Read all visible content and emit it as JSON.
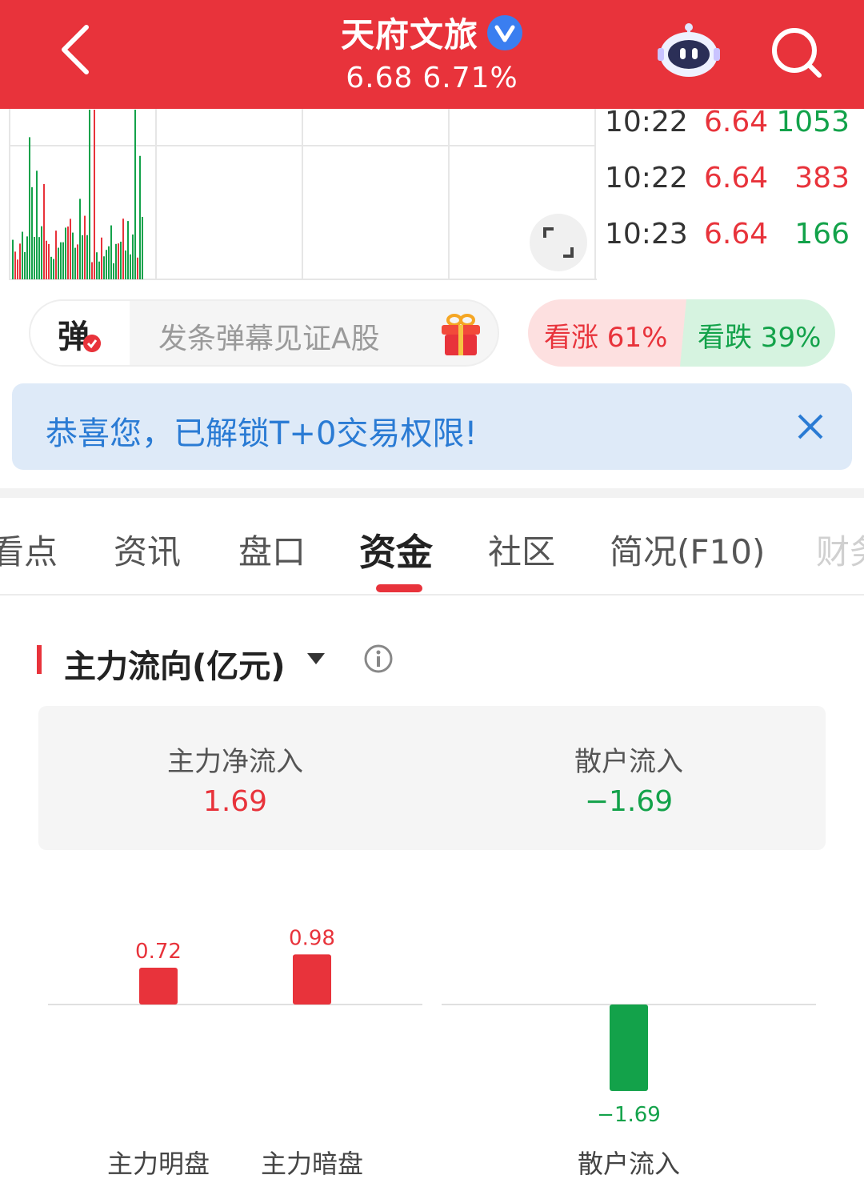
{
  "header": {
    "title": "天府文旅",
    "price": "6.68",
    "change_pct": "6.71%",
    "icons": [
      "back-icon",
      "verified-icon",
      "robot-assistant-icon",
      "search-icon"
    ]
  },
  "colors": {
    "up": "#e8333b",
    "down": "#13a24a",
    "accent": "#e8333b",
    "banner_text": "#2a7bd4"
  },
  "ticks": [
    {
      "time": "10:22",
      "price": "6.64",
      "volume": "1053",
      "dir": "down"
    },
    {
      "time": "10:22",
      "price": "6.64",
      "volume": "383",
      "dir": "up"
    },
    {
      "time": "10:23",
      "price": "6.64",
      "volume": "166",
      "dir": "down"
    }
  ],
  "danmu": {
    "icon_char": "弹",
    "placeholder": "发条弹幕见证A股"
  },
  "sentiment": {
    "bull": "看涨 61%",
    "bear": "看跌 39%",
    "bull_ratio": 0.61
  },
  "banner": {
    "text": "恭喜您，已解锁T+0交易权限!"
  },
  "tabs": [
    {
      "label": "看点"
    },
    {
      "label": "资讯"
    },
    {
      "label": "盘口"
    },
    {
      "label": "资金",
      "active": true
    },
    {
      "label": "社区"
    },
    {
      "label": "简况(F10)"
    },
    {
      "label": "财务"
    }
  ],
  "section": {
    "title": "主力流向(亿元)"
  },
  "summary": {
    "main_label": "主力净流入",
    "main_value": "1.69",
    "retail_label": "散户流入",
    "retail_value": "−1.69"
  },
  "chart_data": {
    "type": "bar",
    "categories": [
      "主力明盘",
      "主力暗盘",
      "散户流入"
    ],
    "values": [
      0.72,
      0.98,
      -1.69
    ],
    "value_labels": [
      "0.72",
      "0.98",
      "−1.69"
    ],
    "ylim": [
      -1.69,
      1.69
    ],
    "title": "",
    "xlabel": "",
    "ylabel": "亿元"
  }
}
